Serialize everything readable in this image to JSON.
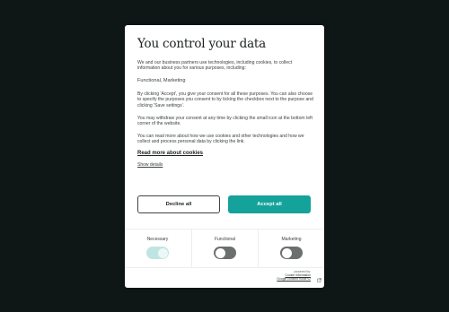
{
  "dialog": {
    "title": "You control your data",
    "paragraphs": {
      "intro": "We and our business partners use technologies, including cookies, to collect information about you for various purposes, including:",
      "purposes": "Functional, Marketing",
      "consent": "By clicking 'Accept', you give your consent for all these purposes. You can also choose to specify the purposes you consent to by ticking the checkbox next to the purpose and clicking 'Save settings'.",
      "withdraw": "You may withdraw your consent at any time by clicking the small icon at the bottom left corner of the website.",
      "more_info": "You can read more about how we use cookies and other technologies and how we collect and process personal data by clicking the link."
    },
    "read_more_link": "Read more about cookies",
    "show_details_link": "Show details",
    "buttons": {
      "decline": "Decline all",
      "accept": "Accept all"
    },
    "categories": [
      {
        "label": "Necessary",
        "enabled": true
      },
      {
        "label": "Functional",
        "enabled": false
      },
      {
        "label": "Marketing",
        "enabled": false
      }
    ],
    "footer": {
      "powered_by": "powered by:",
      "brand_line1": "Cookie Information",
      "brand_line2": "Google consent mode v2"
    }
  },
  "colors": {
    "backdrop": "#0f1716",
    "accent": "#14a29b",
    "toggle_on": "#bfe5e2",
    "toggle_off": "#6b706f"
  }
}
